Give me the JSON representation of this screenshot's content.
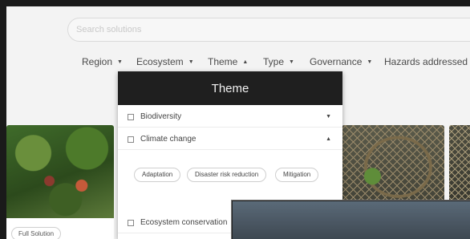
{
  "search": {
    "placeholder": "Search solutions"
  },
  "filters": [
    {
      "label": "Region",
      "arrow": "▼"
    },
    {
      "label": "Ecosystem",
      "arrow": "▼"
    },
    {
      "label": "Theme",
      "arrow": "▲"
    },
    {
      "label": "Type",
      "arrow": "▼"
    },
    {
      "label": "Governance",
      "arrow": "▼"
    },
    {
      "label": "Hazards addressed",
      "arrow": "▼"
    }
  ],
  "dropdown": {
    "title": "Theme",
    "items": [
      {
        "label": "Biodiversity",
        "arrow": "▼"
      },
      {
        "label": "Climate change",
        "arrow": "▲"
      },
      {
        "label": "Ecosystem conservation",
        "arrow": ""
      }
    ],
    "chips": [
      "Adaptation",
      "Disaster risk reduction",
      "Mitigation"
    ]
  },
  "cards": [
    {
      "badge": "Full Solution"
    }
  ]
}
